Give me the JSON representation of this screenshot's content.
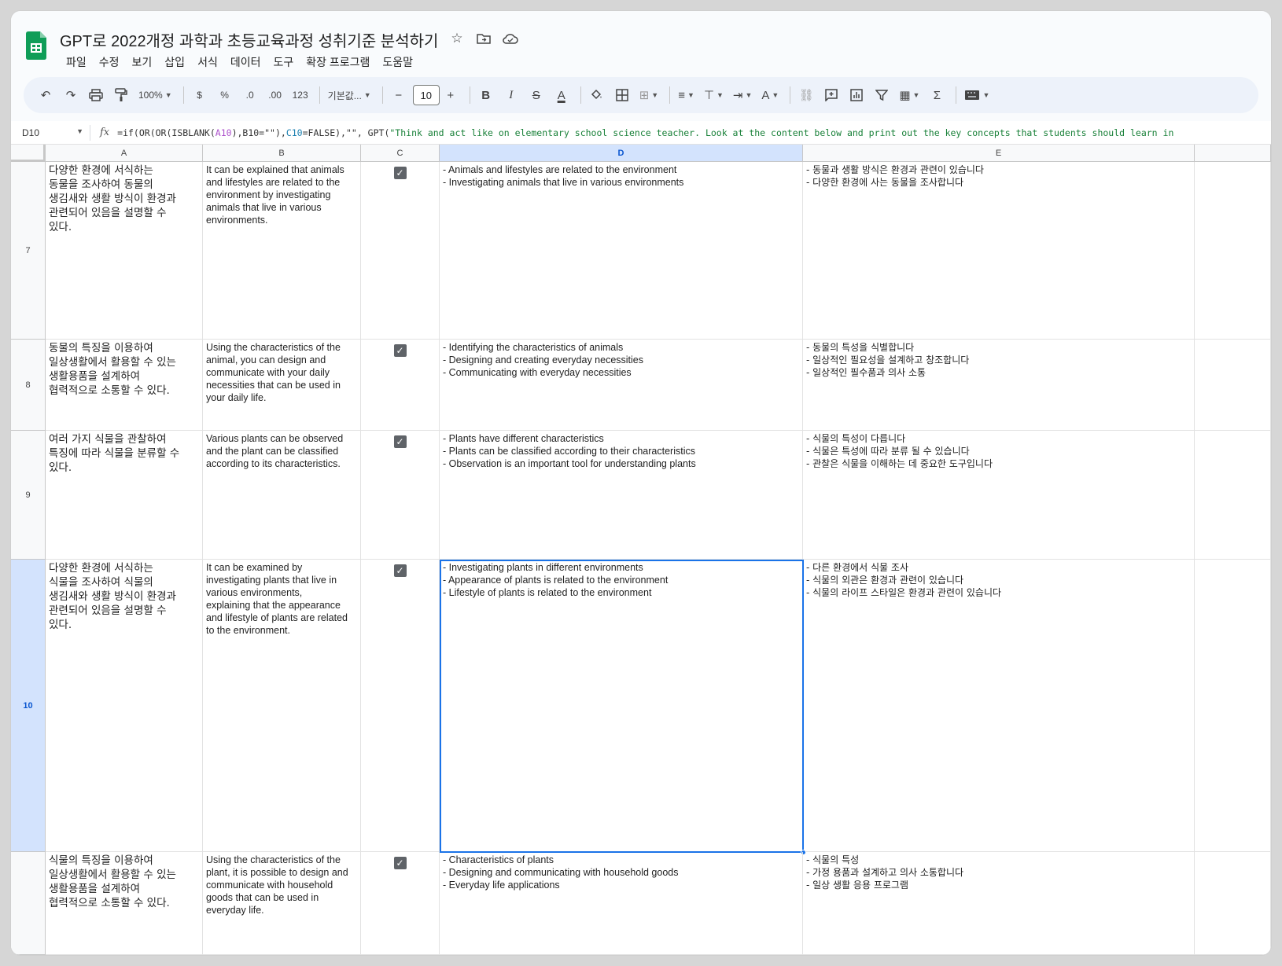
{
  "app": {
    "title": "GPT로 2022개정 과학과 초등교육과정 성취기준 분석하기",
    "menu": [
      "파일",
      "수정",
      "보기",
      "삽입",
      "서식",
      "데이터",
      "도구",
      "확장 프로그램",
      "도움말"
    ]
  },
  "toolbar": {
    "zoom": "100%",
    "currency": "$",
    "percent": "%",
    "dec_decrease": ".0",
    "dec_increase": ".00",
    "number_format": "123",
    "font": "기본값...",
    "font_size": "10",
    "bold": "B",
    "italic": "I",
    "strike": "S",
    "text_color": "A",
    "sigma": "Σ"
  },
  "formula_bar": {
    "cell_ref": "D10",
    "fx": "fx",
    "parts": [
      {
        "text": "=if(OR(OR(ISBLANK(",
        "cls": ""
      },
      {
        "text": "A10",
        "cls": "r1"
      },
      {
        "text": "),B10=\"\"),",
        "cls": ""
      },
      {
        "text": "C10",
        "cls": "r2"
      },
      {
        "text": "=FALSE),\"\", GPT(",
        "cls": ""
      },
      {
        "text": "\"Think and act like on elementary school science teacher. Look at the content below and print out the key concepts that students should learn in",
        "cls": "str"
      }
    ]
  },
  "columns": [
    "A",
    "B",
    "C",
    "D",
    "E"
  ],
  "rows": [
    {
      "num": "7",
      "a": [
        "다양한 환경에 서식하는",
        "동물을 조사하여 동물의",
        "생김새와 생활 방식이 환경과",
        "관련되어 있음을 설명할 수",
        "있다."
      ],
      "b": [
        "It can be explained that animals",
        "and lifestyles are related to the",
        "environment by investigating",
        "animals that live in various",
        "environments."
      ],
      "c": true,
      "d": [
        "- Animals and lifestyles are related to the environment",
        "- Investigating animals that live in various environments"
      ],
      "e": [
        "- 동물과 생활 방식은 환경과 관련이 있습니다",
        "- 다양한 환경에 사는 동물을 조사합니다"
      ]
    },
    {
      "num": "8",
      "a": [
        "동물의 특징을 이용하여",
        "일상생활에서 활용할 수 있는",
        "생활용품을 설계하여",
        "협력적으로 소통할 수 있다."
      ],
      "b": [
        "Using the characteristics of the",
        "animal, you can design and",
        "communicate with your daily",
        "necessities that can be used in",
        "your daily life."
      ],
      "c": true,
      "d": [
        "- Identifying the characteristics of animals",
        "- Designing and creating everyday necessities",
        "- Communicating with everyday necessities"
      ],
      "e": [
        "- 동물의 특성을 식별합니다",
        "- 일상적인 필요성을 설계하고 창조합니다",
        "- 일상적인 필수품과 의사 소통"
      ]
    },
    {
      "num": "9",
      "a": [
        "여러 가지 식물을 관찰하여",
        "특징에 따라 식물을 분류할 수",
        "있다."
      ],
      "b": [
        "Various plants can be observed",
        "and the plant can be classified",
        "according to its characteristics."
      ],
      "c": true,
      "d": [
        "- Plants have different characteristics",
        "- Plants can be classified according to their characteristics",
        "- Observation is an important tool for understanding plants"
      ],
      "e": [
        "- 식물의 특성이 다릅니다",
        "- 식물은 특성에 따라 분류 될 수 있습니다",
        "- 관찰은 식물을 이해하는 데 중요한 도구입니다"
      ]
    },
    {
      "num": "10",
      "a": [
        "다양한 환경에 서식하는",
        "식물을 조사하여 식물의",
        "생김새와 생활 방식이 환경과",
        "관련되어 있음을 설명할 수",
        "있다."
      ],
      "b": [
        "It can be examined by",
        "investigating plants that live in",
        "various environments,",
        "explaining that the appearance",
        "and lifestyle of plants are related",
        "to the environment."
      ],
      "c": true,
      "d": [
        "- Investigating plants in different environments",
        "- Appearance of plants is related to the environment",
        "- Lifestyle of plants is related to the environment"
      ],
      "e": [
        "- 다른 환경에서 식물 조사",
        "- 식물의 외관은 환경과 관련이 있습니다",
        "- 식물의 라이프 스타일은 환경과 관련이 있습니다"
      ]
    },
    {
      "num": "",
      "a": [
        "식물의 특징을 이용하여",
        "일상생활에서 활용할 수 있는",
        "생활용품을 설계하여",
        "협력적으로 소통할 수 있다."
      ],
      "b": [
        "Using the characteristics of the",
        "plant, it is possible to design and",
        "communicate with household",
        "goods that can be used in",
        "everyday life."
      ],
      "c": true,
      "d": [
        "- Characteristics of plants",
        "- Designing and communicating with household goods",
        "- Everyday life applications"
      ],
      "e": [
        "- 식물의 특성",
        "- 가정 용품과 설계하고 의사 소통합니다",
        "- 일상 생활 응용 프로그램"
      ]
    }
  ],
  "selected_row": "10",
  "selected_col": "D",
  "colors": {
    "accent": "#1a73e8",
    "selected_header": "#d3e3fd",
    "sheets_green": "#0f9d58"
  }
}
